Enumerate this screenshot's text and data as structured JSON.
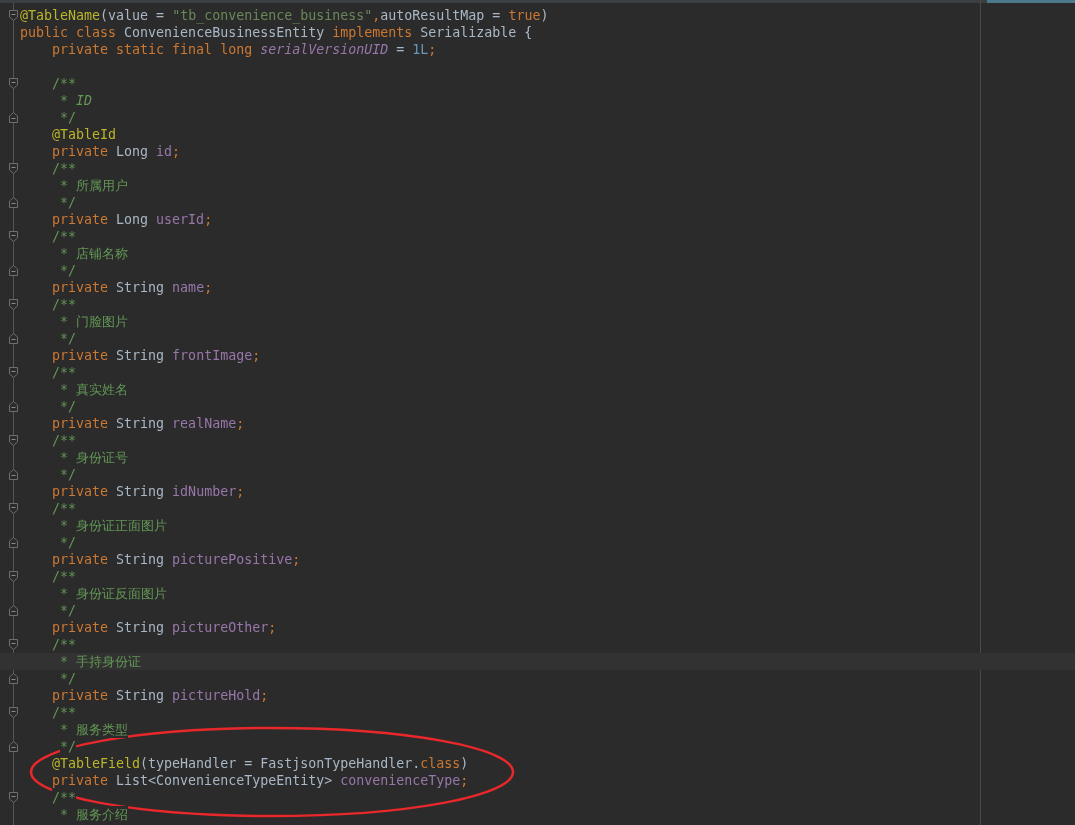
{
  "editor": {
    "lines": [
      {
        "kind": "top-fold",
        "current": false,
        "tokens": [
          {
            "kind": "annotation",
            "text": "@TableName"
          },
          {
            "kind": "plain",
            "text": "(value = "
          },
          {
            "kind": "string",
            "text": "\"tb_convenience_business\""
          },
          {
            "kind": "keyword",
            "text": ","
          },
          {
            "kind": "plain",
            "text": "autoResultMap = "
          },
          {
            "kind": "keyword",
            "text": "true"
          },
          {
            "kind": "plain",
            "text": ")"
          }
        ]
      },
      {
        "kind": "top",
        "current": false,
        "tokens": [
          {
            "kind": "keyword",
            "text": "public class "
          },
          {
            "kind": "plain",
            "text": "ConvenienceBusinessEntity "
          },
          {
            "kind": "keyword",
            "text": "implements "
          },
          {
            "kind": "plain",
            "text": "Serializable {"
          }
        ]
      },
      {
        "kind": "member",
        "current": false,
        "tokens": [
          {
            "kind": "keyword",
            "text": "private static final long "
          },
          {
            "kind": "static",
            "text": "serialVersionUID"
          },
          {
            "kind": "plain",
            "text": " = "
          },
          {
            "kind": "number",
            "text": "1L"
          },
          {
            "kind": "keyword",
            "text": ";"
          }
        ]
      },
      {
        "kind": "blank",
        "current": false
      },
      {
        "kind": "doc-open",
        "current": false,
        "tokens": [
          {
            "kind": "comment",
            "text": "/**"
          }
        ]
      },
      {
        "kind": "doc-text",
        "current": false,
        "tokens": [
          {
            "kind": "comment",
            "text": "* "
          },
          {
            "kind": "comment-italic",
            "text": "ID"
          }
        ]
      },
      {
        "kind": "doc-close",
        "current": false,
        "tokens": [
          {
            "kind": "comment",
            "text": "*/"
          }
        ]
      },
      {
        "kind": "member",
        "current": false,
        "tokens": [
          {
            "kind": "annotation",
            "text": "@TableId"
          }
        ]
      },
      {
        "kind": "member",
        "current": false,
        "tokens": [
          {
            "kind": "keyword",
            "text": "private "
          },
          {
            "kind": "plain",
            "text": "Long "
          },
          {
            "kind": "field",
            "text": "id"
          },
          {
            "kind": "keyword",
            "text": ";"
          }
        ]
      },
      {
        "kind": "doc-open",
        "current": false,
        "tokens": [
          {
            "kind": "comment",
            "text": "/**"
          }
        ]
      },
      {
        "kind": "doc-text",
        "current": false,
        "tokens": [
          {
            "kind": "comment",
            "text": "* 所属用户"
          }
        ]
      },
      {
        "kind": "doc-close",
        "current": false,
        "tokens": [
          {
            "kind": "comment",
            "text": "*/"
          }
        ]
      },
      {
        "kind": "member",
        "current": false,
        "tokens": [
          {
            "kind": "keyword",
            "text": "private "
          },
          {
            "kind": "plain",
            "text": "Long "
          },
          {
            "kind": "field",
            "text": "userId"
          },
          {
            "kind": "keyword",
            "text": ";"
          }
        ]
      },
      {
        "kind": "doc-open",
        "current": false,
        "tokens": [
          {
            "kind": "comment",
            "text": "/**"
          }
        ]
      },
      {
        "kind": "doc-text",
        "current": false,
        "tokens": [
          {
            "kind": "comment",
            "text": "* 店铺名称"
          }
        ]
      },
      {
        "kind": "doc-close",
        "current": false,
        "tokens": [
          {
            "kind": "comment",
            "text": "*/"
          }
        ]
      },
      {
        "kind": "member",
        "current": false,
        "tokens": [
          {
            "kind": "keyword",
            "text": "private "
          },
          {
            "kind": "plain",
            "text": "String "
          },
          {
            "kind": "field",
            "text": "name"
          },
          {
            "kind": "keyword",
            "text": ";"
          }
        ]
      },
      {
        "kind": "doc-open",
        "current": false,
        "tokens": [
          {
            "kind": "comment",
            "text": "/**"
          }
        ]
      },
      {
        "kind": "doc-text",
        "current": false,
        "tokens": [
          {
            "kind": "comment",
            "text": "* 门脸图片"
          }
        ]
      },
      {
        "kind": "doc-close",
        "current": false,
        "tokens": [
          {
            "kind": "comment",
            "text": "*/"
          }
        ]
      },
      {
        "kind": "member",
        "current": false,
        "tokens": [
          {
            "kind": "keyword",
            "text": "private "
          },
          {
            "kind": "plain",
            "text": "String "
          },
          {
            "kind": "field",
            "text": "frontImage"
          },
          {
            "kind": "keyword",
            "text": ";"
          }
        ]
      },
      {
        "kind": "doc-open",
        "current": false,
        "tokens": [
          {
            "kind": "comment",
            "text": "/**"
          }
        ]
      },
      {
        "kind": "doc-text",
        "current": false,
        "tokens": [
          {
            "kind": "comment",
            "text": "* 真实姓名"
          }
        ]
      },
      {
        "kind": "doc-close",
        "current": false,
        "tokens": [
          {
            "kind": "comment",
            "text": "*/"
          }
        ]
      },
      {
        "kind": "member",
        "current": false,
        "tokens": [
          {
            "kind": "keyword",
            "text": "private "
          },
          {
            "kind": "plain",
            "text": "String "
          },
          {
            "kind": "field",
            "text": "realName"
          },
          {
            "kind": "keyword",
            "text": ";"
          }
        ]
      },
      {
        "kind": "doc-open",
        "current": false,
        "tokens": [
          {
            "kind": "comment",
            "text": "/**"
          }
        ]
      },
      {
        "kind": "doc-text",
        "current": false,
        "tokens": [
          {
            "kind": "comment",
            "text": "* 身份证号"
          }
        ]
      },
      {
        "kind": "doc-close",
        "current": false,
        "tokens": [
          {
            "kind": "comment",
            "text": "*/"
          }
        ]
      },
      {
        "kind": "member",
        "current": false,
        "tokens": [
          {
            "kind": "keyword",
            "text": "private "
          },
          {
            "kind": "plain",
            "text": "String "
          },
          {
            "kind": "field",
            "text": "idNumber"
          },
          {
            "kind": "keyword",
            "text": ";"
          }
        ]
      },
      {
        "kind": "doc-open",
        "current": false,
        "tokens": [
          {
            "kind": "comment",
            "text": "/**"
          }
        ]
      },
      {
        "kind": "doc-text",
        "current": false,
        "tokens": [
          {
            "kind": "comment",
            "text": "* 身份证正面图片"
          }
        ]
      },
      {
        "kind": "doc-close",
        "current": false,
        "tokens": [
          {
            "kind": "comment",
            "text": "*/"
          }
        ]
      },
      {
        "kind": "member",
        "current": false,
        "tokens": [
          {
            "kind": "keyword",
            "text": "private "
          },
          {
            "kind": "plain",
            "text": "String "
          },
          {
            "kind": "field",
            "text": "picturePositive"
          },
          {
            "kind": "keyword",
            "text": ";"
          }
        ]
      },
      {
        "kind": "doc-open",
        "current": false,
        "tokens": [
          {
            "kind": "comment",
            "text": "/**"
          }
        ]
      },
      {
        "kind": "doc-text",
        "current": false,
        "tokens": [
          {
            "kind": "comment",
            "text": "* 身份证反面图片"
          }
        ]
      },
      {
        "kind": "doc-close",
        "current": false,
        "tokens": [
          {
            "kind": "comment",
            "text": "*/"
          }
        ]
      },
      {
        "kind": "member",
        "current": false,
        "tokens": [
          {
            "kind": "keyword",
            "text": "private "
          },
          {
            "kind": "plain",
            "text": "String "
          },
          {
            "kind": "field",
            "text": "pictureOther"
          },
          {
            "kind": "keyword",
            "text": ";"
          }
        ]
      },
      {
        "kind": "doc-open",
        "current": false,
        "tokens": [
          {
            "kind": "comment",
            "text": "/**"
          }
        ]
      },
      {
        "kind": "doc-text",
        "current": true,
        "tokens": [
          {
            "kind": "comment",
            "text": "* 手持身份证"
          }
        ]
      },
      {
        "kind": "doc-close",
        "current": false,
        "tokens": [
          {
            "kind": "comment",
            "text": "*/"
          }
        ]
      },
      {
        "kind": "member",
        "current": false,
        "tokens": [
          {
            "kind": "keyword",
            "text": "private "
          },
          {
            "kind": "plain",
            "text": "String "
          },
          {
            "kind": "field",
            "text": "pictureHold"
          },
          {
            "kind": "keyword",
            "text": ";"
          }
        ]
      },
      {
        "kind": "doc-open",
        "current": false,
        "tokens": [
          {
            "kind": "comment",
            "text": "/**"
          }
        ]
      },
      {
        "kind": "doc-text",
        "current": false,
        "tokens": [
          {
            "kind": "comment",
            "text": "* 服务类型"
          }
        ]
      },
      {
        "kind": "doc-close",
        "current": false,
        "tokens": [
          {
            "kind": "comment",
            "text": "*/"
          }
        ]
      },
      {
        "kind": "member",
        "current": false,
        "tokens": [
          {
            "kind": "annotation",
            "text": "@TableField"
          },
          {
            "kind": "plain",
            "text": "(typeHandler = FastjsonTypeHandler."
          },
          {
            "kind": "keyword",
            "text": "class"
          },
          {
            "kind": "plain",
            "text": ")"
          }
        ]
      },
      {
        "kind": "member",
        "current": false,
        "tokens": [
          {
            "kind": "keyword",
            "text": "private "
          },
          {
            "kind": "plain",
            "text": "List<ConvenienceTypeEntity> "
          },
          {
            "kind": "field",
            "text": "convenienceType"
          },
          {
            "kind": "keyword",
            "text": ";"
          }
        ]
      },
      {
        "kind": "doc-open",
        "current": false,
        "tokens": [
          {
            "kind": "comment",
            "text": "/**"
          }
        ]
      },
      {
        "kind": "doc-text",
        "current": false,
        "tokens": [
          {
            "kind": "comment",
            "text": "* 服务介绍"
          }
        ]
      }
    ]
  }
}
